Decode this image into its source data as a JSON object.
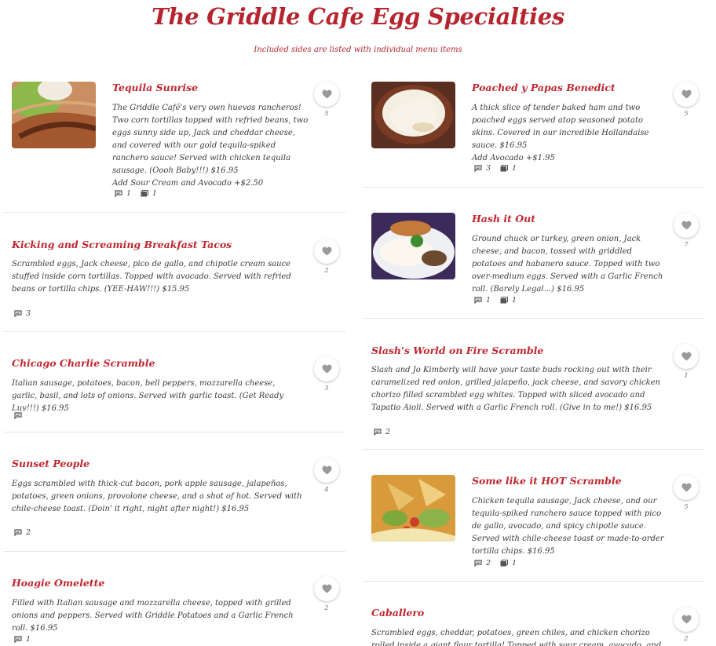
{
  "page": {
    "title": "The Griddle Cafe Egg Specialties",
    "subtitle": "Included sides are listed with individual menu items"
  },
  "left": [
    {
      "title": "Tequila Sunrise",
      "desc": "The Griddle Café's very own huevos rancheros! Two corn tortillas topped with refried beans, two eggs sunny side up, Jack and cheddar cheese, and covered with our gold tequila-spiked ranchero sauce! Served with chicken tequila sausage. (Oooh Baby!!!) $16.95",
      "extra": "Add Sour Cream and Avocado +$2.50",
      "likes": "5",
      "comments": "1",
      "photos": "1"
    },
    {
      "title": "Kicking and Screaming Breakfast Tacos",
      "desc": "Scrambled eggs, Jack cheese, pico de gallo, and chipotle cream sauce stuffed inside corn tortillas. Topped with avocado. Served with refried beans or tortilla chips. (YEE-HAW!!!) $15.95",
      "likes": "2",
      "comments": "3"
    },
    {
      "title": "Chicago Charlie Scramble",
      "desc": "Italian sausage, potatoes, bacon, bell peppers, mozzarella cheese, garlic, basil, and lots of onions. Served with garlic toast. (Get Ready Luv!!!) $16.95",
      "likes": "3",
      "comments": ""
    },
    {
      "title": "Sunset People",
      "desc": "Eggs scrambled with thick-cut bacon, pork apple sausage, jalapeños, potatoes, green onions, provolone cheese, and a shot of hot. Served with chile-cheese toast. (Doin' it right, night after night!) $16.95",
      "likes": "4",
      "comments": "2"
    },
    {
      "title": "Hoagie Omelette",
      "desc": "Filled with Italian sausage and mozzarella cheese, topped with grilled onions and peppers. Served with Griddle Potatoes and a Garlic French roll. $16.95",
      "likes": "2",
      "comments": "1"
    }
  ],
  "right": [
    {
      "title": "Poached y Papas Benedict",
      "desc": "A thick slice of tender baked ham and two poached eggs served atop seasoned potato skins. Covered in our incredible Hollandaise sauce. $16.95",
      "extra": "Add Avocado +$1.95",
      "likes": "5",
      "comments": "3",
      "photos": "1"
    },
    {
      "title": "Hash it Out",
      "desc": "Ground chuck or turkey, green onion, Jack cheese, and bacon, tossed with griddled potatoes and habanero sauce. Topped with two over-medium eggs. Served with a Garlic French roll. (Barely Legal...) $16.95",
      "likes": "7",
      "comments": "1",
      "photos": "1"
    },
    {
      "title": "Slash's World on Fire Scramble",
      "desc": "Slash and Jo Kimberly will have your taste buds rocking out with their caramelized red onion, grilled jalapeño, jack cheese, and savory chicken chorizo filled scrambled egg whites. Topped with sliced avocado and Tapatio Aioli. Served with a Garlic French roll. (Give in to me!) $16.95",
      "likes": "1",
      "comments": "2"
    },
    {
      "title": "Some like it HOT Scramble",
      "desc": "Chicken tequila sausage, Jack cheese, and our tequila-spiked ranchero sauce topped with pico de gallo, avocado, and spicy chipotle sauce. Served with chile-cheese toast or made-to-order tortilla chips. $16.95",
      "likes": "5",
      "comments": "2",
      "photos": "1"
    },
    {
      "title": "Caballero",
      "desc": "Scrambled eggs, cheddar, potatoes, green chiles, and chicken chorizo rolled inside a giant flour tortilla! Topped with sour cream, avocado, and pico de gallo. Served with",
      "likes": "2"
    }
  ],
  "colors": {
    "accent": "#c0262f",
    "divider": "#e6e6e6"
  },
  "icons": {
    "like": "heart-icon",
    "comments": "comment-icon",
    "photos": "photo-icon"
  }
}
